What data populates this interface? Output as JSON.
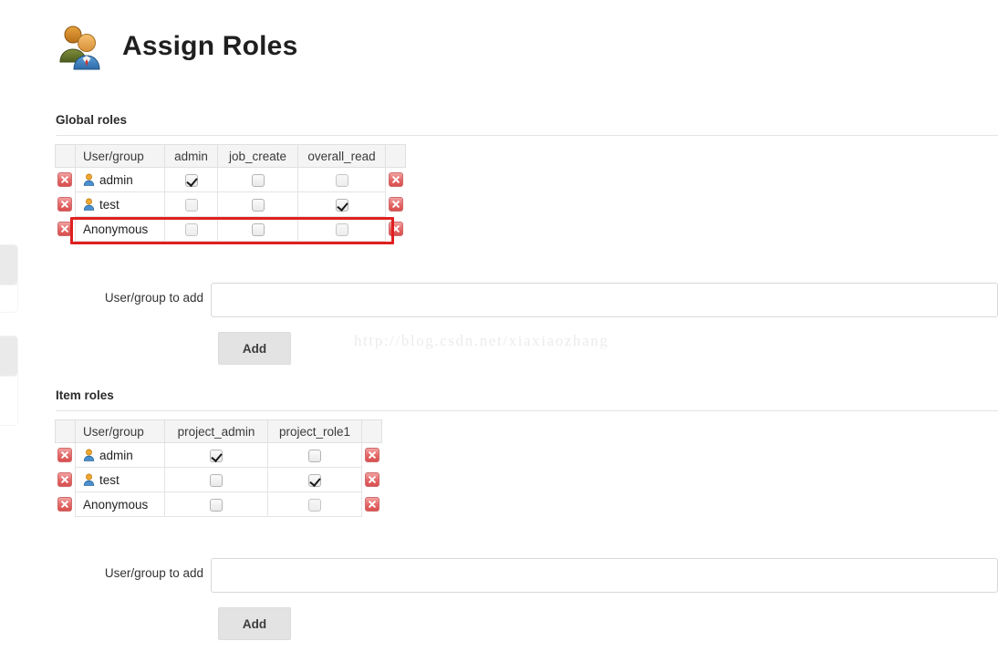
{
  "header": {
    "title": "Assign Roles",
    "icon": "people-group-icon"
  },
  "watermark": {
    "text": "http://blog.csdn.net/xiaxiaozhang"
  },
  "global_roles": {
    "heading": "Global roles",
    "columns": [
      "User/group",
      "admin",
      "job_create",
      "overall_read"
    ],
    "rows": [
      {
        "name": "admin",
        "has_user_icon": true,
        "checks": [
          true,
          false,
          false
        ]
      },
      {
        "name": "test",
        "has_user_icon": true,
        "checks": [
          false,
          false,
          true
        ]
      },
      {
        "name": "Anonymous",
        "has_user_icon": false,
        "checks": [
          false,
          false,
          false
        ]
      }
    ],
    "highlighted_row": "Anonymous",
    "highlight_color": "#e02020",
    "form": {
      "label": "User/group to add",
      "value": "",
      "placeholder": "",
      "add_label": "Add"
    }
  },
  "item_roles": {
    "heading": "Item roles",
    "columns": [
      "User/group",
      "project_admin",
      "project_role1"
    ],
    "rows": [
      {
        "name": "admin",
        "has_user_icon": true,
        "checks": [
          true,
          false
        ]
      },
      {
        "name": "test",
        "has_user_icon": true,
        "checks": [
          false,
          true
        ]
      },
      {
        "name": "Anonymous",
        "has_user_icon": false,
        "checks": [
          false,
          false
        ]
      }
    ],
    "form": {
      "label": "User/group to add",
      "value": "",
      "placeholder": "",
      "add_label": "Add"
    }
  },
  "icons": {
    "delete_row": "delete-red-x-icon",
    "user": "user-silhouette-icon"
  }
}
